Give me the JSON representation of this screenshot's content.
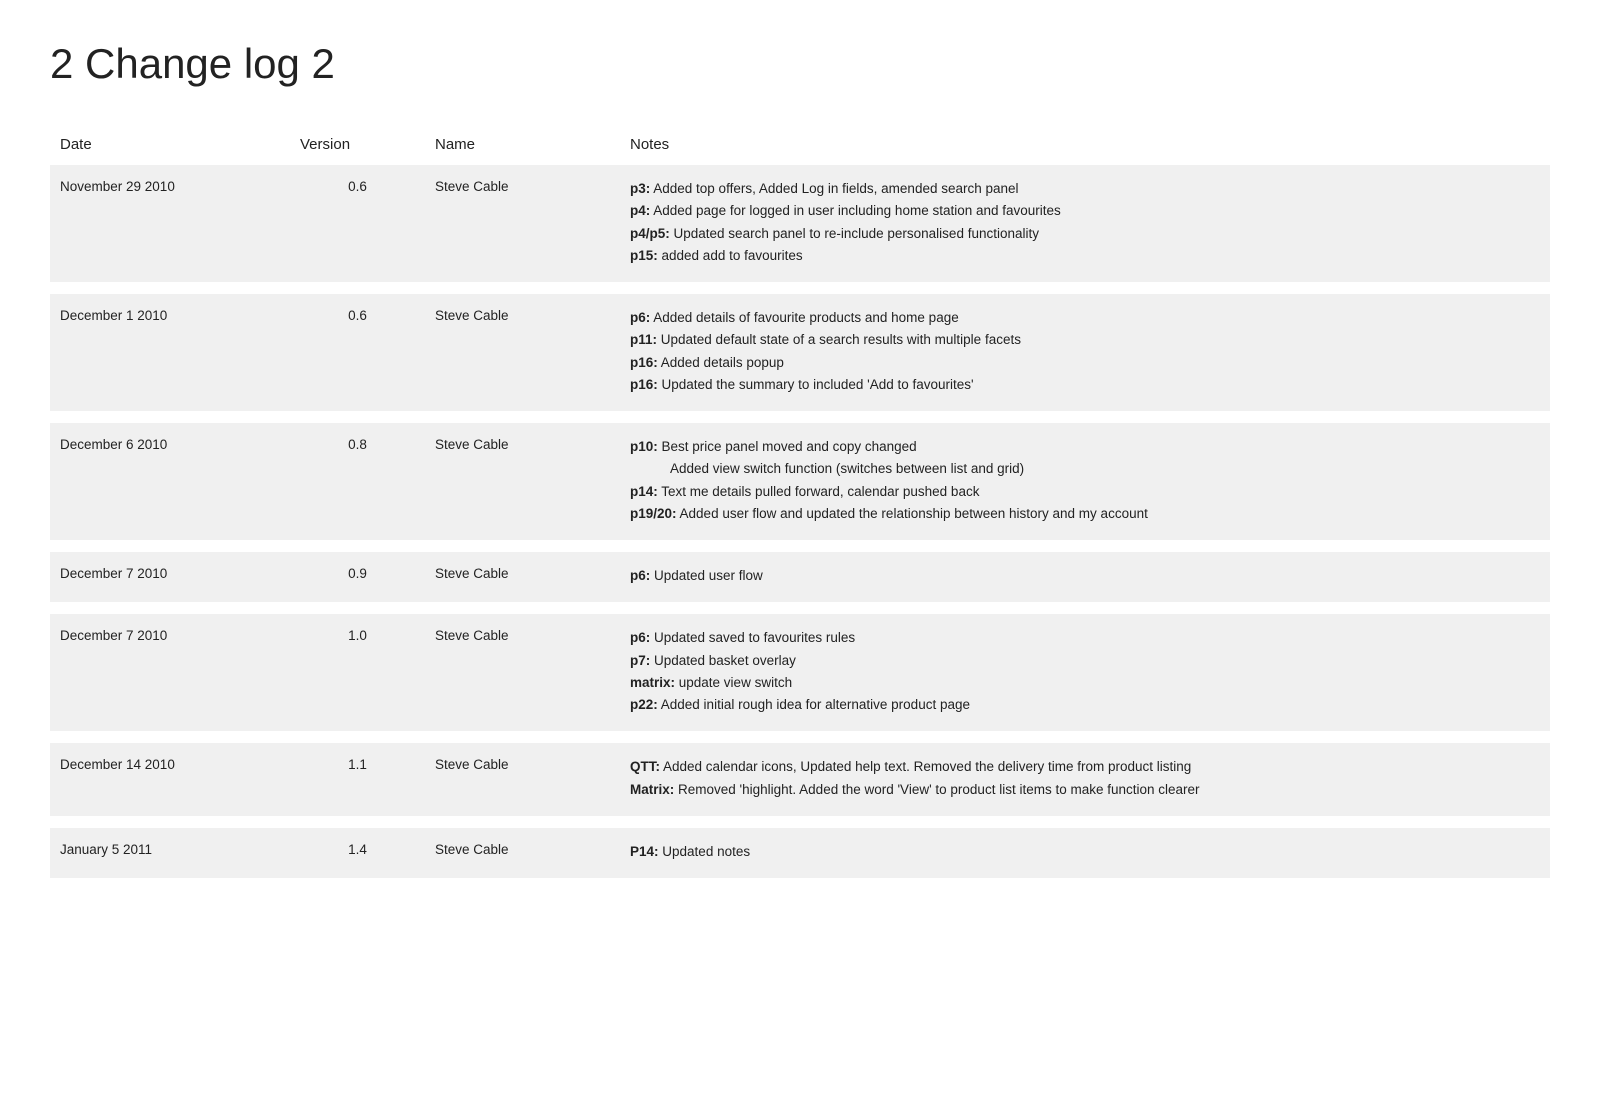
{
  "page": {
    "title": "2 Change log 2"
  },
  "table": {
    "headers": {
      "date": "Date",
      "version": "Version",
      "name": "Name",
      "notes": "Notes"
    },
    "rows": [
      {
        "date": "November 29 2010",
        "version": "0.6",
        "name": "Steve Cable",
        "notes": [
          {
            "label": "p3:",
            "text": " Added top offers, Added Log in fields, amended search panel"
          },
          {
            "label": "p4:",
            "text": " Added page for logged in user including home station and favourites"
          },
          {
            "label": "p4/p5:",
            "text": " Updated search panel to re-include personalised functionality"
          },
          {
            "label": "p15:",
            "text": " added add to favourites"
          }
        ]
      },
      {
        "date": "December 1 2010",
        "version": "0.6",
        "name": "Steve Cable",
        "notes": [
          {
            "label": "p6:",
            "text": " Added details of favourite products and home page"
          },
          {
            "label": "p11:",
            "text": " Updated default state of a search results with multiple facets"
          },
          {
            "label": "p16:",
            "text": " Added details popup"
          },
          {
            "label": "p16:",
            "text": " Updated the summary to included 'Add to favourites'"
          }
        ]
      },
      {
        "date": "December 6 2010",
        "version": "0.8",
        "name": "Steve Cable",
        "notes": [
          {
            "label": "p10:",
            "text": " Best price panel moved and copy changed"
          },
          {
            "label": "",
            "text": "Added view switch function (switches between list and grid)",
            "indent": true
          },
          {
            "label": "p14:",
            "text": " Text me details pulled forward, calendar pushed back"
          },
          {
            "label": "",
            "text": ""
          },
          {
            "label": "p19/20:",
            "text": " Added user flow and updated the relationship between history and my account"
          }
        ]
      },
      {
        "date": "December 7 2010",
        "version": "0.9",
        "name": "Steve Cable",
        "notes": [
          {
            "label": "p6:",
            "text": " Updated user flow"
          }
        ]
      },
      {
        "date": "December 7 2010",
        "version": "1.0",
        "name": "Steve Cable",
        "notes": [
          {
            "label": "p6:",
            "text": " Updated saved to favourites rules"
          },
          {
            "label": "p7:",
            "text": " Updated basket overlay"
          },
          {
            "label": "matrix:",
            "text": " update view switch"
          },
          {
            "label": "p22:",
            "text": " Added initial rough idea for alternative product page"
          }
        ]
      },
      {
        "date": "December 14 2010",
        "version": "1.1",
        "name": "Steve Cable",
        "notes": [
          {
            "label": "QTT:",
            "text": " Added calendar icons,  Updated help text. Removed the delivery time from product listing"
          },
          {
            "label": "Matrix:",
            "text": " Removed 'highlight. Added the word 'View' to product list items to make function clearer"
          }
        ]
      },
      {
        "date": "January 5 2011",
        "version": "1.4",
        "name": "Steve Cable",
        "notes": [
          {
            "label": "P14:",
            "text": " Updated notes"
          }
        ]
      }
    ]
  }
}
